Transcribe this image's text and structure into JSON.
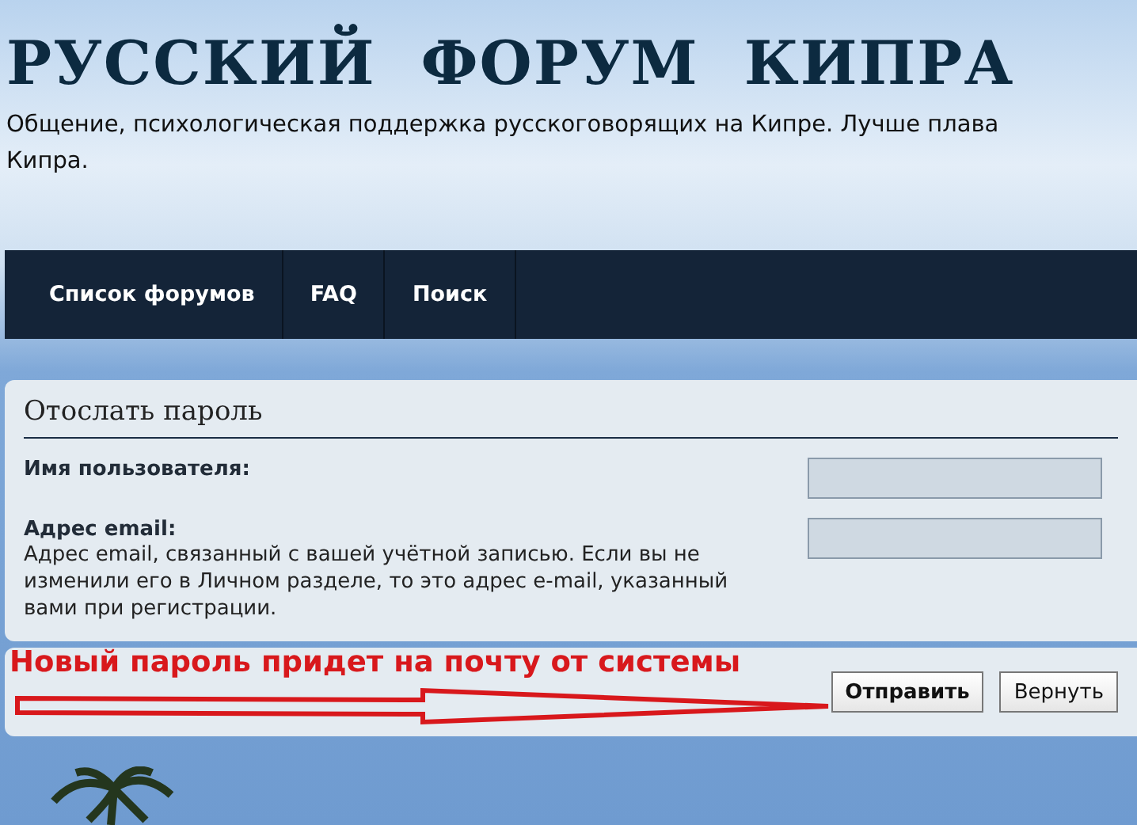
{
  "header": {
    "title": "РУССКИЙ  ФОРУМ  КИПРА",
    "tagline": [
      "Общение, психологическая поддержка русскоговорящих на Кипре. Лучше плава",
      "Кипра."
    ]
  },
  "nav": [
    {
      "label": "Список форумов"
    },
    {
      "label": "FAQ"
    },
    {
      "label": "Поиск"
    }
  ],
  "form": {
    "title": "Отослать пароль",
    "fields": [
      {
        "label": "Имя пользователя:"
      },
      {
        "label": "Адрес email:",
        "hint": "Адрес email, связанный с вашей учётной записью. Если вы не изменили его в Личном разделе, то это адрес e-mail, указанный вами при регистрации."
      }
    ],
    "buttons": [
      {
        "label": "Отправить",
        "kind": "primary"
      },
      {
        "label": "Вернуть",
        "kind": "secondary"
      }
    ]
  },
  "annotation": {
    "text": "Новый пароль придет на почту от системы"
  }
}
